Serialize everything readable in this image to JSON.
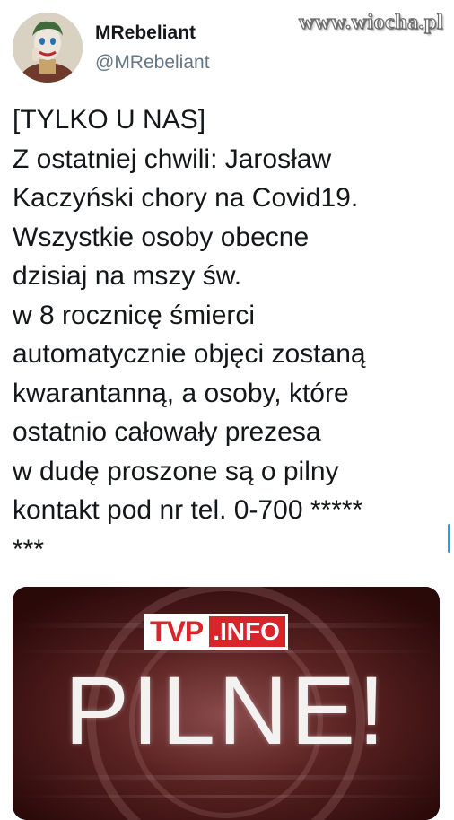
{
  "watermark": "www.wiocha.pl",
  "tweet": {
    "display_name": "MRebeliant",
    "handle": "@MRebeliant",
    "text_lines": [
      "[TYLKO U NAS]",
      "Z ostatniej chwili: Jarosław",
      "Kaczyński chory na Covid19.",
      "Wszystkie osoby obecne",
      "dzisiaj na mszy św.",
      "w 8 rocznicę śmierci",
      "automatycznie objęci zostaną",
      "kwarantanną, a osoby, które",
      "ostatnio całowały prezesa",
      "w dudę proszone są o pilny",
      "kontakt pod nr tel. 0-700 *****",
      "***"
    ]
  },
  "media": {
    "logo_tvp": "TVP",
    "logo_info": ".INFO",
    "headline": "PILNE!"
  },
  "colors": {
    "text": "#14171a",
    "secondary": "#657786",
    "accent": "#1da1f2",
    "tvp_red": "#d8242a"
  }
}
